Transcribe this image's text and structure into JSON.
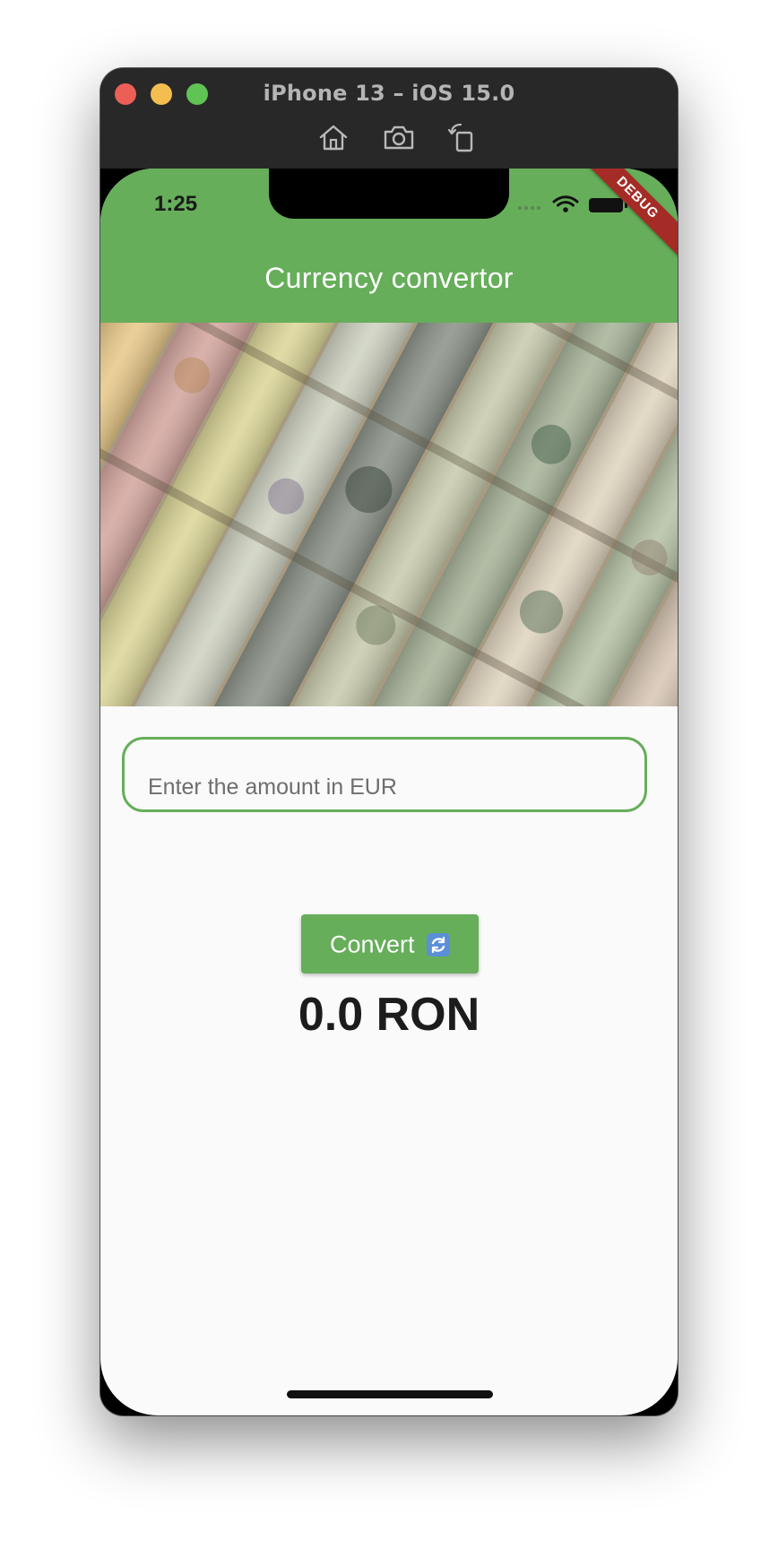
{
  "window": {
    "title": "iPhone 13 – iOS 15.0"
  },
  "status_bar": {
    "time": "1:25"
  },
  "debug_banner": {
    "label": "DEBUG"
  },
  "app_bar": {
    "title": "Currency convertor",
    "color": "#66ae5a"
  },
  "banner": {
    "icon": "banknotes-photo"
  },
  "amount_input": {
    "value": "",
    "placeholder": "Enter the amount in EUR"
  },
  "convert_button": {
    "label": "Convert",
    "icon": "refresh-icon"
  },
  "result": {
    "text": "0.0 RON"
  }
}
